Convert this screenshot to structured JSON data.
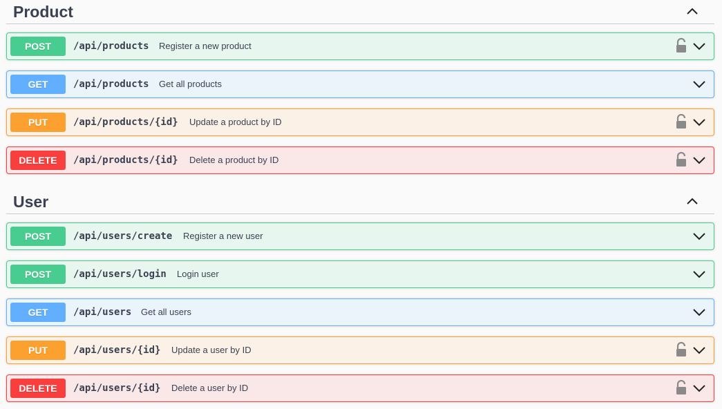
{
  "sections": [
    {
      "title": "Product",
      "operations": [
        {
          "method": "POST",
          "path": "/api/products",
          "summary": "Register a new product",
          "locked": true
        },
        {
          "method": "GET",
          "path": "/api/products",
          "summary": "Get all products",
          "locked": false
        },
        {
          "method": "PUT",
          "path": "/api/products/{id}",
          "summary": "Update a product by ID",
          "locked": true
        },
        {
          "method": "DELETE",
          "path": "/api/products/{id}",
          "summary": "Delete a product by ID",
          "locked": true
        }
      ]
    },
    {
      "title": "User",
      "operations": [
        {
          "method": "POST",
          "path": "/api/users/create",
          "summary": "Register a new user",
          "locked": false
        },
        {
          "method": "POST",
          "path": "/api/users/login",
          "summary": "Login user",
          "locked": false
        },
        {
          "method": "GET",
          "path": "/api/users",
          "summary": "Get all users",
          "locked": false
        },
        {
          "method": "PUT",
          "path": "/api/users/{id}",
          "summary": "Update a user by ID",
          "locked": true
        },
        {
          "method": "DELETE",
          "path": "/api/users/{id}",
          "summary": "Delete a user by ID",
          "locked": true
        }
      ]
    }
  ],
  "colors": {
    "POST": "#49cc90",
    "GET": "#61affe",
    "PUT": "#fca130",
    "DELETE": "#f93e3e"
  },
  "icons": {
    "collapse": "chevron-up-icon",
    "expand": "chevron-down-icon",
    "auth": "unlocked-padlock-icon"
  }
}
